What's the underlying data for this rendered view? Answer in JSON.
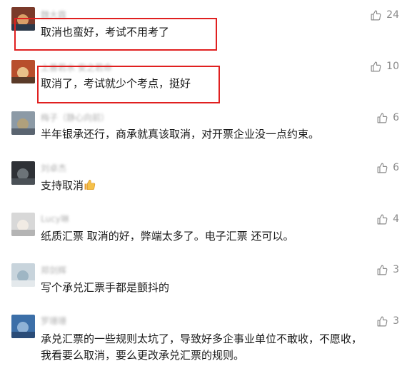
{
  "comments": [
    {
      "name": "魏大霖",
      "text": "取消也蛮好，考试不用考了",
      "likes": "24",
      "avatar_colors": [
        "#7a3a2a",
        "#d9a068",
        "#2c3a4a"
      ]
    },
    {
      "name": "上善若水 安之若命",
      "text": "取消了，考试就少个考点，挺好",
      "likes": "10",
      "avatar_colors": [
        "#b84e2c",
        "#e8c089",
        "#5a3a28"
      ]
    },
    {
      "name": "梅子（静心向前）",
      "text": "半年银承还行，商承就真该取消，对开票企业没一点约束。",
      "likes": "6",
      "avatar_colors": [
        "#8c9aa6",
        "#b0a07c",
        "#5a6470"
      ]
    },
    {
      "name": "刘卓杰",
      "text": "支持取消",
      "likes": "6",
      "avatar_colors": [
        "#2e3136",
        "#6c7378",
        "#4a5056"
      ]
    },
    {
      "name": "Lucy琳",
      "text": "纸质汇票 取消的好，弊端太多了。电子汇票 还可以。",
      "likes": "4",
      "avatar_colors": [
        "#d8d8d8",
        "#f1ebe4",
        "#b4b4b4"
      ]
    },
    {
      "name": "郑剑辉",
      "text": "写个承兑汇票手都是颤抖的",
      "likes": "3",
      "avatar_colors": [
        "#c8d4dc",
        "#9fb6c4",
        "#e4e9ec"
      ]
    },
    {
      "name": "罗珊珊",
      "text": "承兑汇票的一些规则太坑了，导致好多企事业单位不敢收，不愿收，",
      "text2": "我看要么取消，要么更改承兑汇票的规则。",
      "likes": "3",
      "avatar_colors": [
        "#3c6fa8",
        "#8fb2d6",
        "#2a4c78"
      ]
    }
  ],
  "highlight_color": "#e02020",
  "icons": {
    "like": "thumbs-up-outline-icon",
    "emoji": "thumbs-up-emoji-icon"
  }
}
